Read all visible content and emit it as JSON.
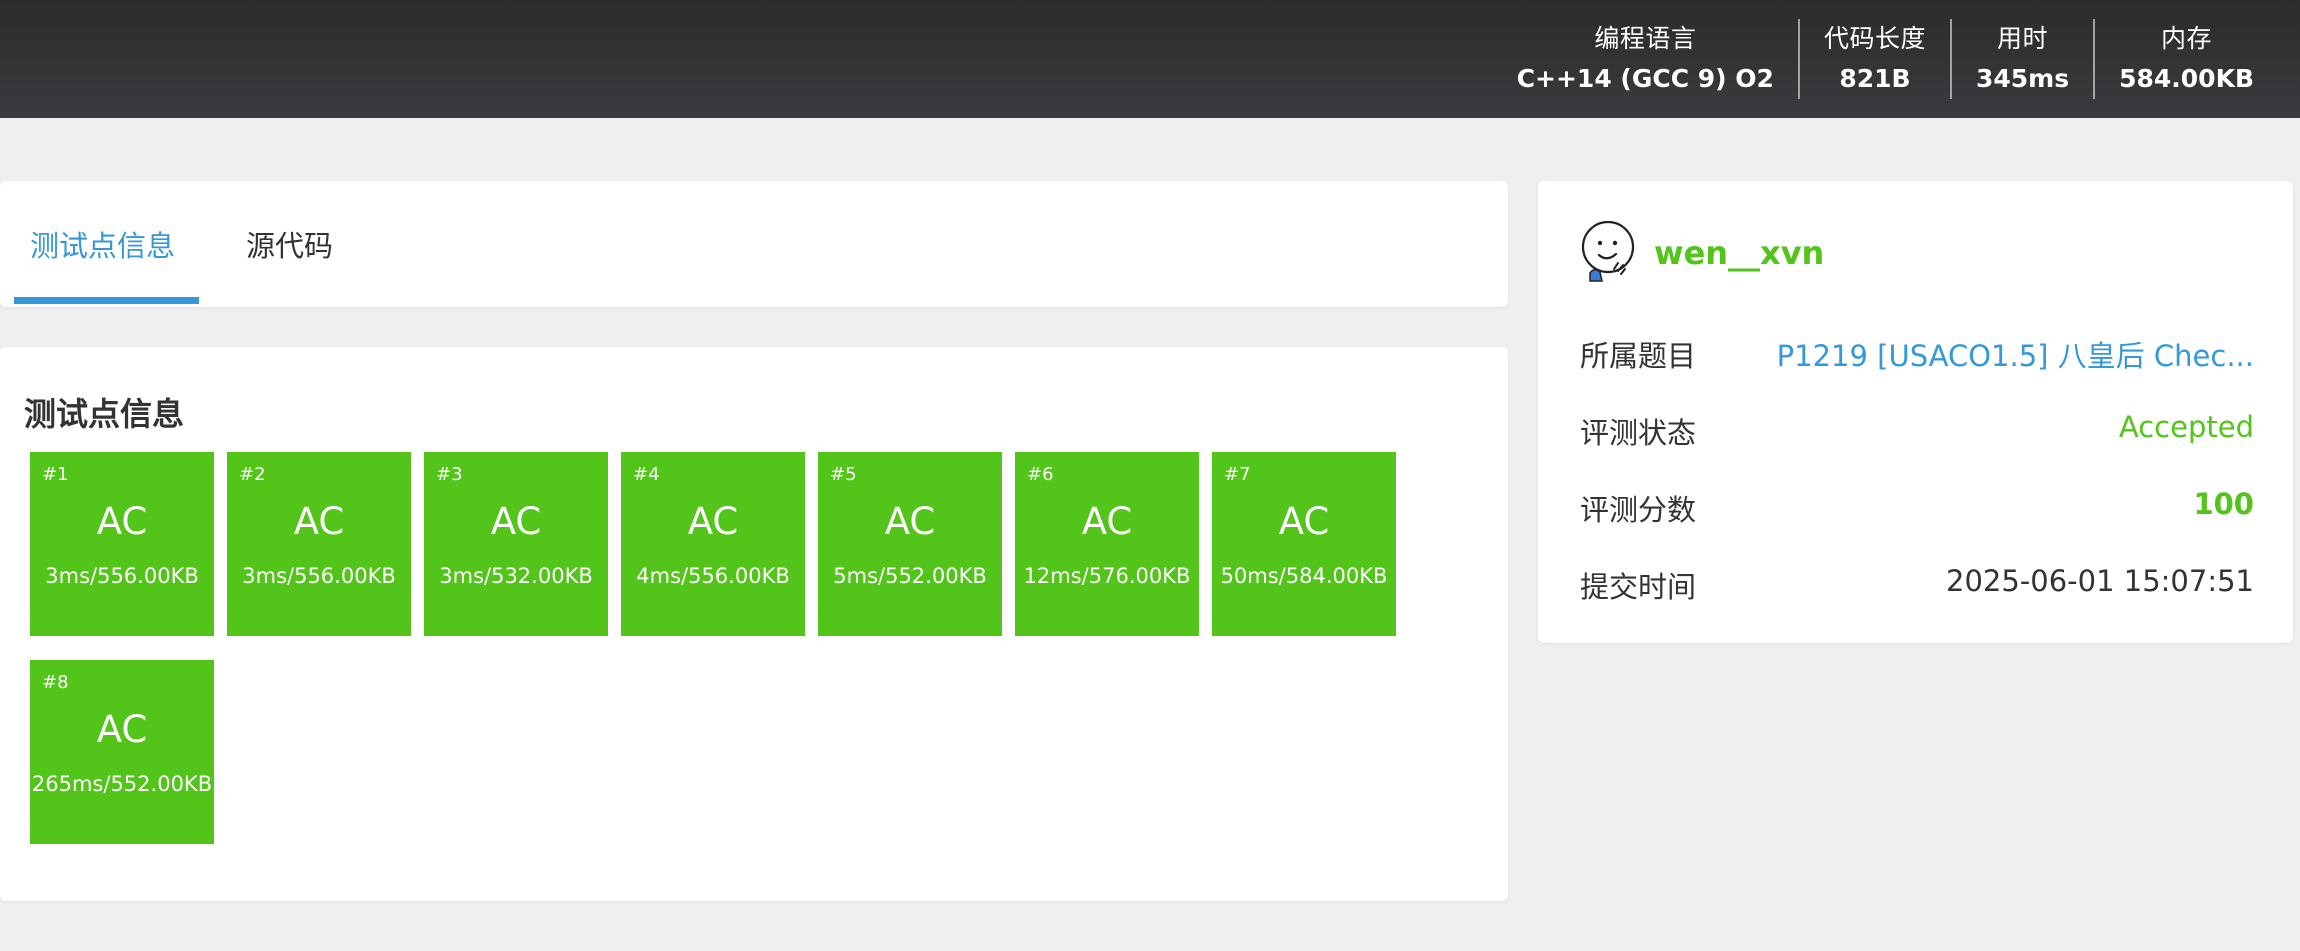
{
  "header": {
    "stats": [
      {
        "label": "编程语言",
        "value": "C++14 (GCC 9) O2"
      },
      {
        "label": "代码长度",
        "value": "821B"
      },
      {
        "label": "用时",
        "value": "345ms"
      },
      {
        "label": "内存",
        "value": "584.00KB"
      }
    ]
  },
  "tabs": [
    {
      "label": "测试点信息",
      "active": true
    },
    {
      "label": "源代码",
      "active": false
    }
  ],
  "cases": {
    "title": "测试点信息",
    "items": [
      {
        "num": "#1",
        "status": "AC",
        "info": "3ms/556.00KB"
      },
      {
        "num": "#2",
        "status": "AC",
        "info": "3ms/556.00KB"
      },
      {
        "num": "#3",
        "status": "AC",
        "info": "3ms/532.00KB"
      },
      {
        "num": "#4",
        "status": "AC",
        "info": "4ms/556.00KB"
      },
      {
        "num": "#5",
        "status": "AC",
        "info": "5ms/552.00KB"
      },
      {
        "num": "#6",
        "status": "AC",
        "info": "12ms/576.00KB"
      },
      {
        "num": "#7",
        "status": "AC",
        "info": "50ms/584.00KB"
      },
      {
        "num": "#8",
        "status": "AC",
        "info": "265ms/552.00KB"
      }
    ],
    "color": "#52c41a"
  },
  "side": {
    "avatar_icon": "smiling-face-avatar-icon",
    "username": "wen__xvn",
    "rows": [
      {
        "label": "所属题目",
        "value": "P1219 [USACO1.5] 八皇后 Chec..."
      },
      {
        "label": "评测状态",
        "value": "Accepted"
      },
      {
        "label": "评测分数",
        "value": "100"
      },
      {
        "label": "提交时间",
        "value": "2025-06-01 15:07:51"
      }
    ]
  },
  "colors": {
    "accent": "#3498db",
    "success": "#52c41a",
    "header_bg": "#2f3033"
  }
}
